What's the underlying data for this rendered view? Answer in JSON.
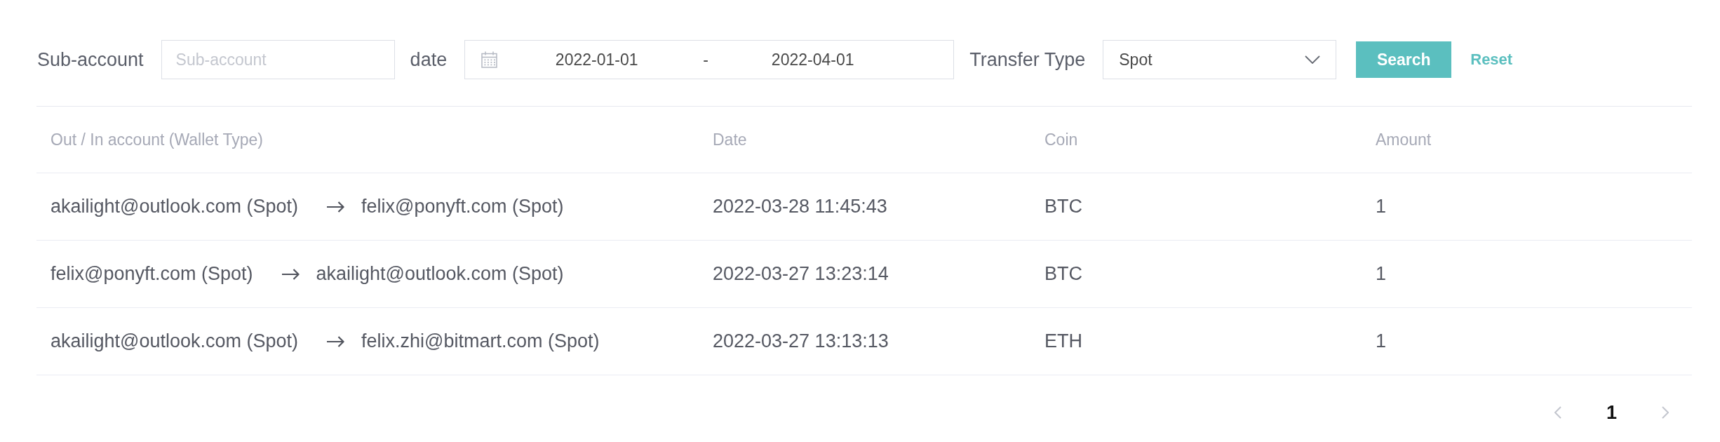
{
  "filters": {
    "sub_account": {
      "label": "Sub-account",
      "placeholder": "Sub-account"
    },
    "date": {
      "label": "date",
      "start": "2022-01-01",
      "separator": "-",
      "end": "2022-04-01"
    },
    "transfer_type": {
      "label": "Transfer Type",
      "value": "Spot"
    },
    "buttons": [
      {
        "kind": "primary",
        "label": "Search"
      },
      {
        "kind": "link",
        "label": "Reset"
      }
    ]
  },
  "table": {
    "columns": [
      "Out / In account (Wallet Type)",
      "Date",
      "Coin",
      "Amount"
    ],
    "rows": [
      {
        "from": "akailight@outlook.com (Spot)",
        "to": "felix@ponyft.com (Spot)",
        "date": "2022-03-28 11:45:43",
        "coin": "BTC",
        "amount": "1"
      },
      {
        "from": "felix@ponyft.com (Spot)",
        "to": "akailight@outlook.com (Spot)",
        "date": "2022-03-27 13:23:14",
        "coin": "BTC",
        "amount": "1"
      },
      {
        "from": "akailight@outlook.com (Spot)",
        "to": "felix.zhi@bitmart.com (Spot)",
        "date": "2022-03-27 13:13:13",
        "coin": "ETH",
        "amount": "1"
      }
    ]
  },
  "pagination": {
    "prev": {
      "disabled": true
    },
    "pages": [
      {
        "label": "1",
        "selected": true
      }
    ],
    "next": {
      "disabled": true
    }
  }
}
